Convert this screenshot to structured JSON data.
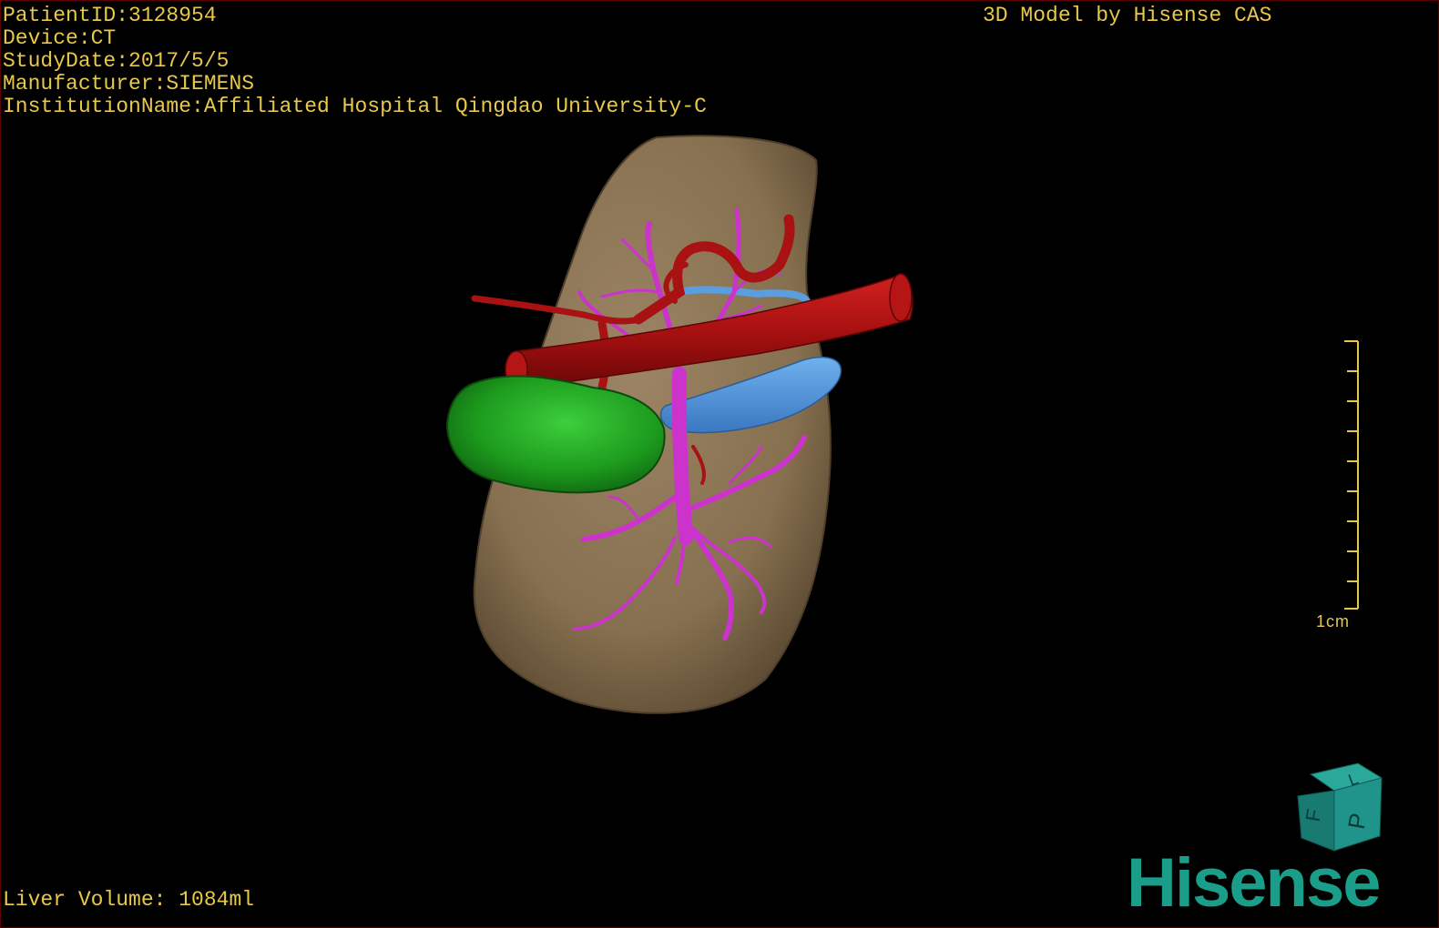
{
  "patient_info": {
    "patient_id": "PatientID:3128954",
    "device": "Device:CT",
    "study_date": "StudyDate:2017/5/5",
    "manufacturer": "Manufacturer:SIEMENS",
    "institution": "InstitutionName:Affiliated Hospital Qingdao University-C"
  },
  "watermark": "3D Model by Hisense CAS",
  "liver_volume": "Liver Volume: 1084ml",
  "scale_bar": {
    "label": "1cm"
  },
  "orientation_cube": {
    "faces": [
      "F",
      "L",
      "P"
    ]
  },
  "brand": "Hisense",
  "colors": {
    "text": "#e8c84a",
    "liver": "#8b7355",
    "artery": "#b01515",
    "portal_vein": "#cc33cc",
    "hepatic_vein": "#4a90d9",
    "gallbladder": "#1f9a1f",
    "cube": "#1c8c80",
    "brand": "#1a9e8a"
  }
}
